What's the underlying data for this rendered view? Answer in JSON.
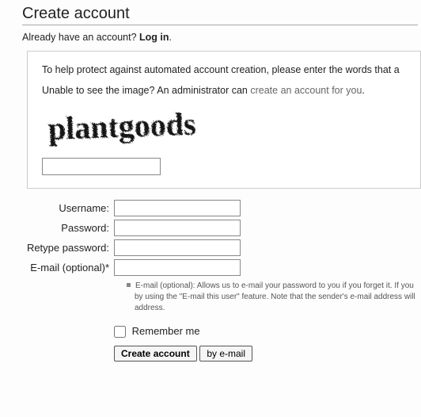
{
  "heading": "Create account",
  "already": {
    "text": "Already have an account? ",
    "login": "Log in",
    "suffix": "."
  },
  "captcha": {
    "line1": "To help protect against automated account creation, please enter the words that a",
    "line2_prefix": "Unable to see the image? An administrator can ",
    "line2_link": "create an account for you",
    "line2_suffix": ".",
    "image_text": "plantgoods",
    "input_value": ""
  },
  "form": {
    "username": {
      "label": "Username:",
      "value": ""
    },
    "password": {
      "label": "Password:",
      "value": ""
    },
    "retype": {
      "label": "Retype password:",
      "value": ""
    },
    "email": {
      "label": "E-mail (optional)*",
      "value": ""
    },
    "email_hint_lines": [
      "E-mail (optional): Allows us to e-mail your password to you if you forget it. If you",
      "by using the \"E-mail this user\" feature. Note that the sender's e-mail address will",
      "address."
    ]
  },
  "remember": {
    "label": "Remember me",
    "checked": false
  },
  "buttons": {
    "submit": "Create account",
    "byemail": "by e-mail"
  }
}
